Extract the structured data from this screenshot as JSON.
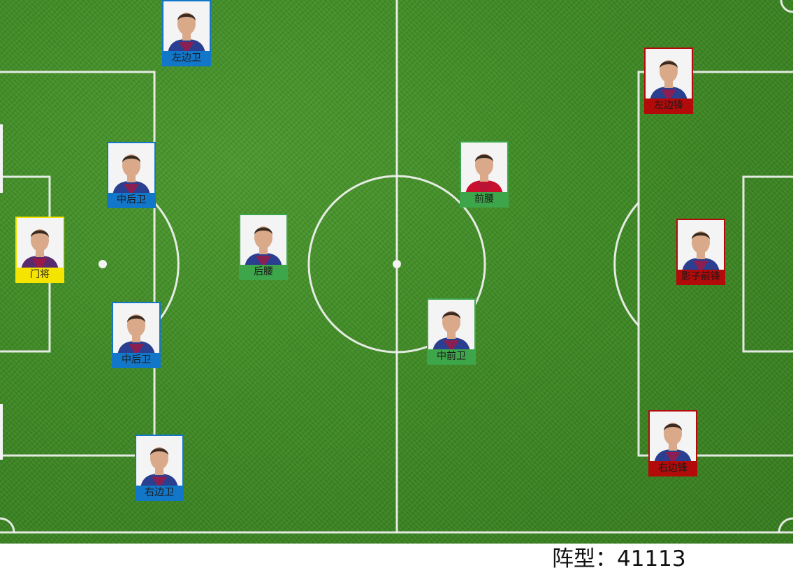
{
  "colors": {
    "pitch": "#3d8a24",
    "goalkeeper": "#f5e400",
    "defender": "#1276c9",
    "midfielder": "#3ea64a",
    "forward": "#b30a0a"
  },
  "players": [
    {
      "key": "left-back",
      "label": "左边卫",
      "role": "df",
      "icon": "player-photo-icon"
    },
    {
      "key": "center-back-1",
      "label": "中后卫",
      "role": "df",
      "icon": "player-photo-icon"
    },
    {
      "key": "goalkeeper",
      "label": "门将",
      "role": "gk",
      "icon": "player-photo-icon"
    },
    {
      "key": "center-back-2",
      "label": "中后卫",
      "role": "df",
      "icon": "player-photo-icon"
    },
    {
      "key": "right-back",
      "label": "右边卫",
      "role": "df",
      "icon": "player-photo-icon"
    },
    {
      "key": "defensive-mid",
      "label": "后腰",
      "role": "mf",
      "icon": "player-photo-icon"
    },
    {
      "key": "attacking-mid",
      "label": "前腰",
      "role": "mf",
      "icon": "player-photo-icon"
    },
    {
      "key": "central-mid",
      "label": "中前卫",
      "role": "mf",
      "icon": "player-photo-icon"
    },
    {
      "key": "left-wing",
      "label": "左边锋",
      "role": "fw",
      "icon": "player-photo-icon"
    },
    {
      "key": "second-striker",
      "label": "影子前锋",
      "role": "fw",
      "icon": "player-photo-icon"
    },
    {
      "key": "right-wing",
      "label": "右边锋",
      "role": "fw",
      "icon": "player-photo-icon"
    }
  ],
  "formation": {
    "text": "阵型：41113"
  }
}
